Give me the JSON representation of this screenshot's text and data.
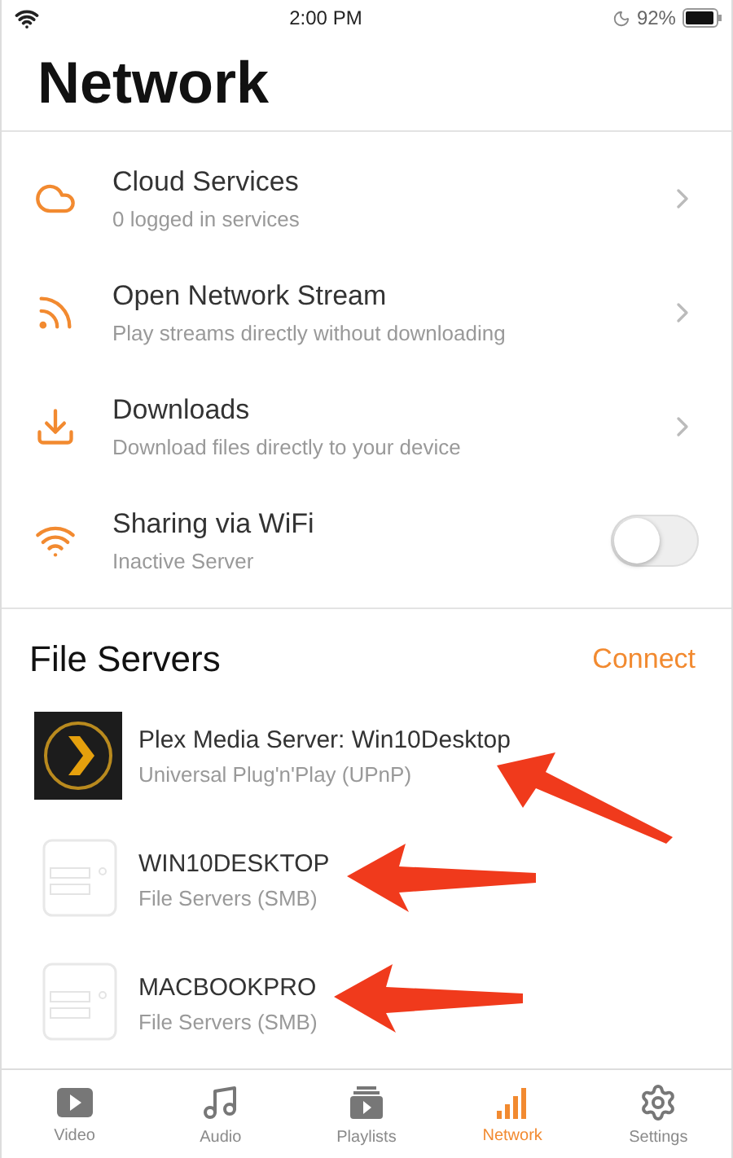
{
  "status_bar": {
    "time": "2:00 PM",
    "battery": "92%"
  },
  "title": "Network",
  "menu": [
    {
      "kind": "link",
      "title": "Cloud Services",
      "subtitle": "0 logged in services"
    },
    {
      "kind": "link",
      "title": "Open Network Stream",
      "subtitle": "Play streams directly without downloading"
    },
    {
      "kind": "link",
      "title": "Downloads",
      "subtitle": "Download files directly to your device"
    },
    {
      "kind": "toggle",
      "title": "Sharing via WiFi",
      "subtitle": "Inactive Server",
      "on": false
    }
  ],
  "file_servers": {
    "title": "File Servers",
    "action": "Connect",
    "items": [
      {
        "kind": "plex",
        "name": "Plex Media Server: Win10Desktop",
        "protocol": "Universal Plug'n'Play (UPnP)"
      },
      {
        "kind": "smb",
        "name": "WIN10DESKTOP",
        "protocol": "File Servers (SMB)"
      },
      {
        "kind": "smb",
        "name": "MACBOOKPRO",
        "protocol": "File Servers (SMB)"
      }
    ]
  },
  "tabs": [
    {
      "label": "Video",
      "selected": false
    },
    {
      "label": "Audio",
      "selected": false
    },
    {
      "label": "Playlists",
      "selected": false
    },
    {
      "label": "Network",
      "selected": true
    },
    {
      "label": "Settings",
      "selected": false
    }
  ]
}
